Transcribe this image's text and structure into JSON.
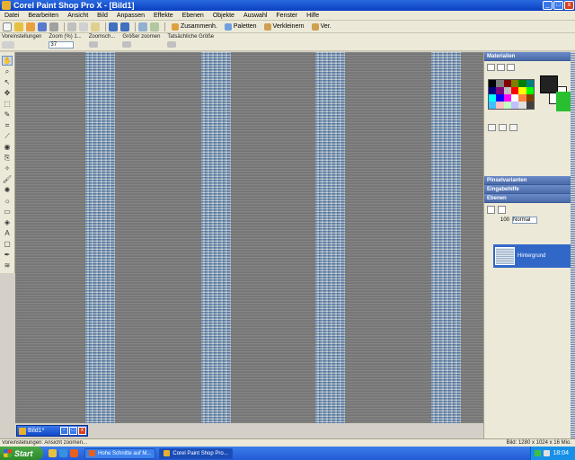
{
  "window": {
    "title": "Corel Paint Shop Pro X - [Bild1]",
    "controls": {
      "minimize": "_",
      "maximize": "□",
      "close": "x"
    }
  },
  "menu": [
    "Datei",
    "Bearbeiten",
    "Ansicht",
    "Bild",
    "Anpassen",
    "Effekte",
    "Ebenen",
    "Objekte",
    "Auswahl",
    "Fenster",
    "Hilfe"
  ],
  "toolbar": {
    "buttons": [
      "Zusammenh.",
      "Paletten",
      "Verkleinern",
      "Ver."
    ]
  },
  "options": {
    "groups": [
      {
        "label": "Voreinstellungen",
        "value": ""
      },
      {
        "label": "Zoom (%) 1...",
        "value": "37"
      },
      {
        "label": "Zoomsch...",
        "value": ""
      },
      {
        "label": "Größer zoomen",
        "value": ""
      },
      {
        "label": "Tatsächliche Größe",
        "value": ""
      }
    ]
  },
  "document": {
    "tab_title": "Bild1*"
  },
  "palettes": {
    "materials": "Materialien",
    "brush_variance": "Pinselvarianten",
    "info": "Eingabehilfe",
    "layers": "Ebenen",
    "layer_opacity": "100",
    "blend_mode": "Normal",
    "layer_name": "Hintergrund"
  },
  "colors": {
    "swatches": [
      "#000000",
      "#808080",
      "#800000",
      "#808000",
      "#008000",
      "#008080",
      "#000080",
      "#800080",
      "#c0c0c0",
      "#ff0000",
      "#ffff00",
      "#00ff00",
      "#00ffff",
      "#0000ff",
      "#ff00ff",
      "#ffffff",
      "#ff8040",
      "#804000",
      "#40c0ff",
      "#ffc0c0",
      "#c0ffc0",
      "#c0c0ff",
      "#e0e0e0",
      "#404040"
    ]
  },
  "status": {
    "left": "Voreinstellungen: Ansicht zoomen...",
    "right": "Bild: 1280 x 1024 x 16 Mio."
  },
  "taskbar": {
    "start": "Start",
    "tasks": [
      "Hohe Schnitte auf M...",
      "Corel Paint Shop Pro..."
    ],
    "clock": "18:04"
  }
}
